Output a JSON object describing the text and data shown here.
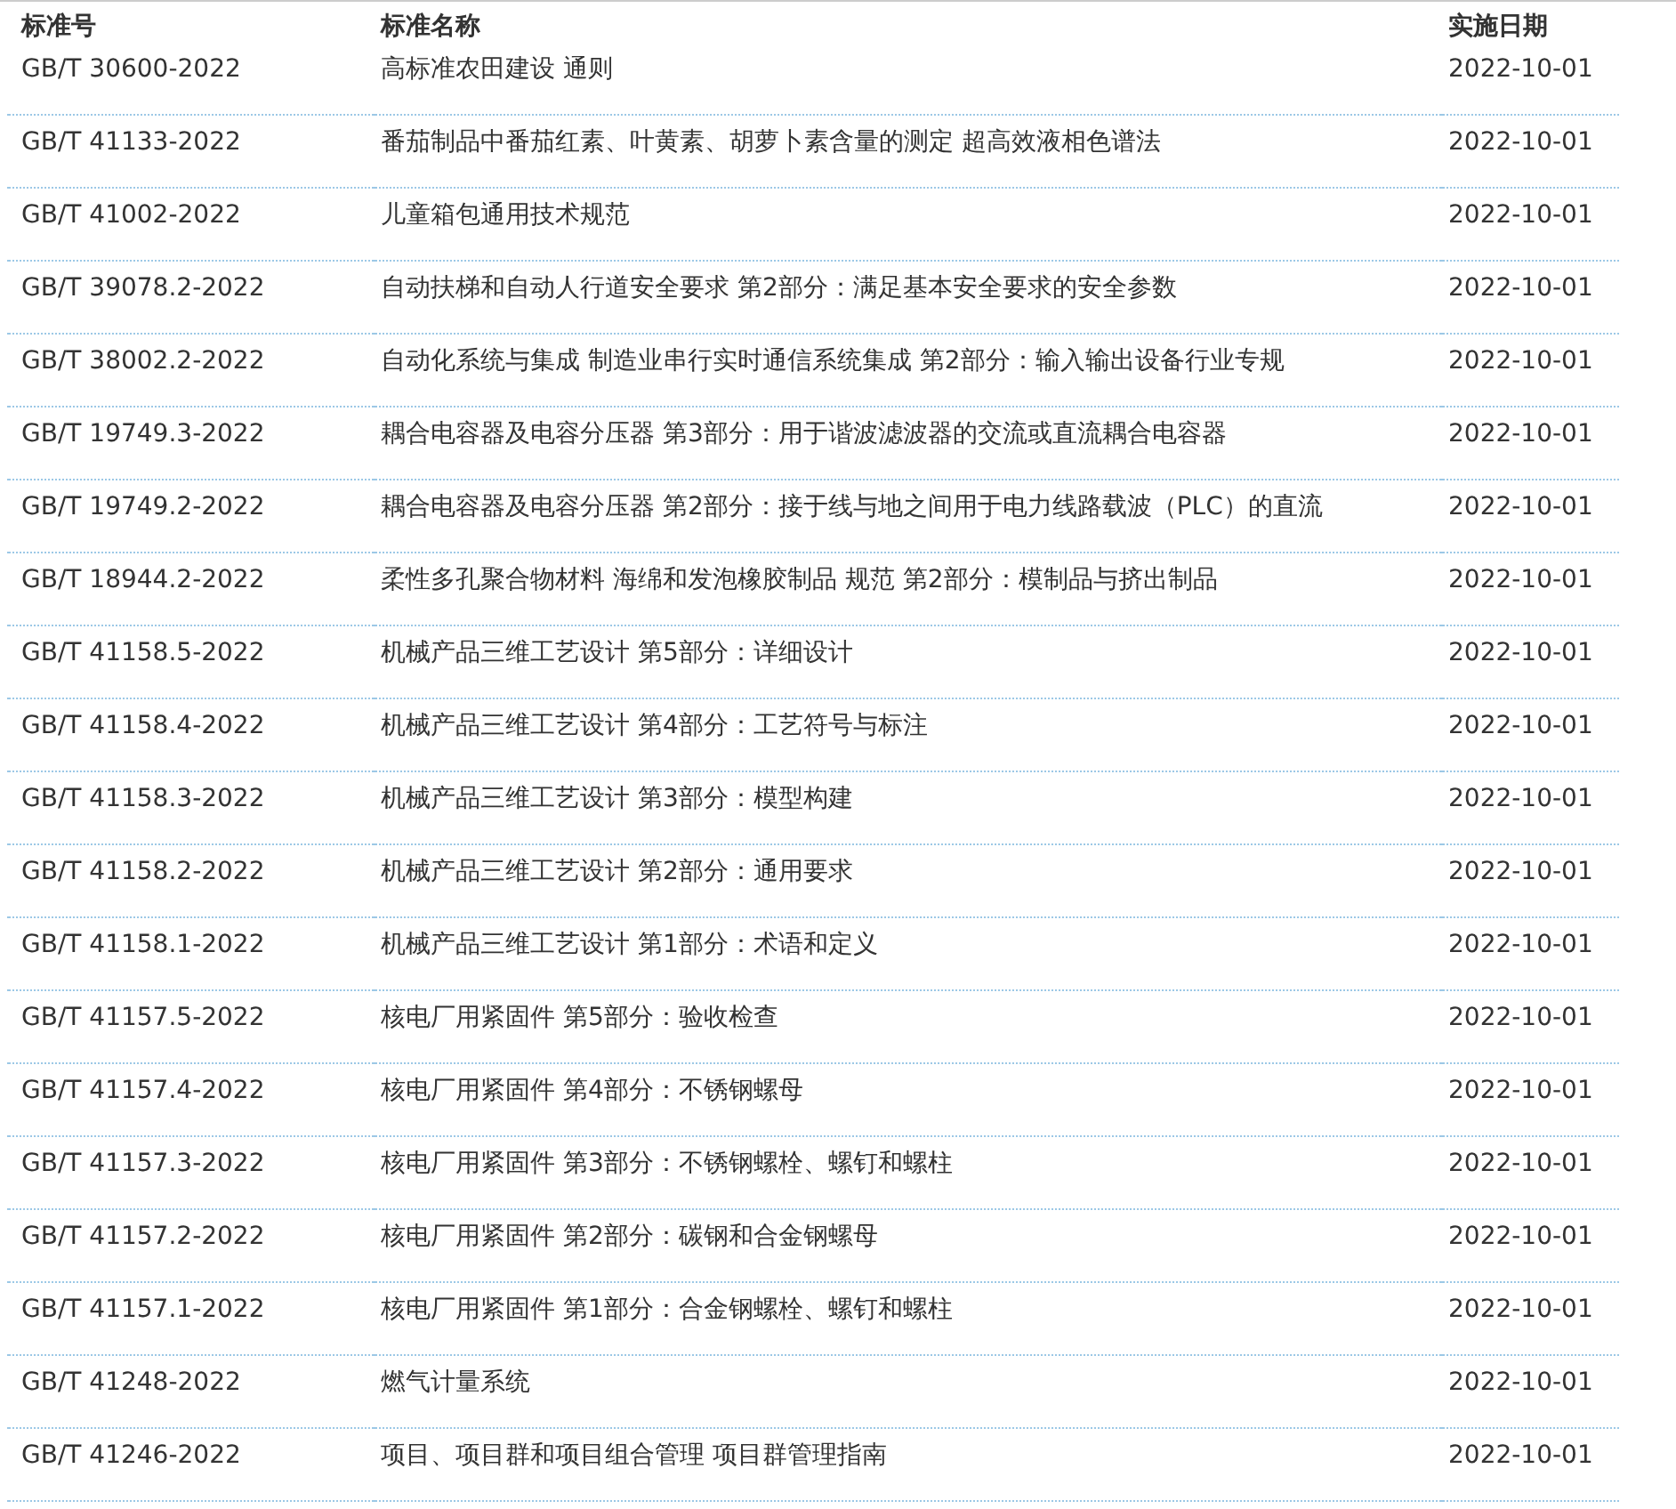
{
  "table": {
    "columns": [
      "标准号",
      "标准名称",
      "实施日期"
    ],
    "rows": [
      {
        "code": "GB/T 30600-2022",
        "name": "高标准农田建设 通则",
        "date": "2022-10-01"
      },
      {
        "code": "GB/T 41133-2022",
        "name": "番茄制品中番茄红素、叶黄素、胡萝卜素含量的测定 超高效液相色谱法",
        "date": "2022-10-01"
      },
      {
        "code": "GB/T 41002-2022",
        "name": "儿童箱包通用技术规范",
        "date": "2022-10-01"
      },
      {
        "code": "GB/T 39078.2-2022",
        "name": "自动扶梯和自动人行道安全要求 第2部分：满足基本安全要求的安全参数",
        "date": "2022-10-01"
      },
      {
        "code": "GB/T 38002.2-2022",
        "name": "自动化系统与集成 制造业串行实时通信系统集成 第2部分：输入输出设备行业专规",
        "date": "2022-10-01"
      },
      {
        "code": "GB/T 19749.3-2022",
        "name": "耦合电容器及电容分压器 第3部分：用于谐波滤波器的交流或直流耦合电容器",
        "date": "2022-10-01"
      },
      {
        "code": "GB/T 19749.2-2022",
        "name": "耦合电容器及电容分压器 第2部分：接于线与地之间用于电力线路载波（PLC）的直流",
        "date": "2022-10-01"
      },
      {
        "code": "GB/T 18944.2-2022",
        "name": "柔性多孔聚合物材料 海绵和发泡橡胶制品 规范 第2部分：模制品与挤出制品",
        "date": "2022-10-01"
      },
      {
        "code": "GB/T 41158.5-2022",
        "name": "机械产品三维工艺设计 第5部分：详细设计",
        "date": "2022-10-01"
      },
      {
        "code": "GB/T 41158.4-2022",
        "name": "机械产品三维工艺设计 第4部分：工艺符号与标注",
        "date": "2022-10-01"
      },
      {
        "code": "GB/T 41158.3-2022",
        "name": "机械产品三维工艺设计 第3部分：模型构建",
        "date": "2022-10-01"
      },
      {
        "code": "GB/T 41158.2-2022",
        "name": "机械产品三维工艺设计 第2部分：通用要求",
        "date": "2022-10-01"
      },
      {
        "code": "GB/T 41158.1-2022",
        "name": "机械产品三维工艺设计 第1部分：术语和定义",
        "date": "2022-10-01"
      },
      {
        "code": "GB/T 41157.5-2022",
        "name": "核电厂用紧固件 第5部分：验收检查",
        "date": "2022-10-01"
      },
      {
        "code": "GB/T 41157.4-2022",
        "name": "核电厂用紧固件 第4部分：不锈钢螺母",
        "date": "2022-10-01"
      },
      {
        "code": "GB/T 41157.3-2022",
        "name": "核电厂用紧固件 第3部分：不锈钢螺栓、螺钉和螺柱",
        "date": "2022-10-01"
      },
      {
        "code": "GB/T 41157.2-2022",
        "name": "核电厂用紧固件 第2部分：碳钢和合金钢螺母",
        "date": "2022-10-01"
      },
      {
        "code": "GB/T 41157.1-2022",
        "name": "核电厂用紧固件 第1部分：合金钢螺栓、螺钉和螺柱",
        "date": "2022-10-01"
      },
      {
        "code": "GB/T 41248-2022",
        "name": "燃气计量系统",
        "date": "2022-10-01"
      },
      {
        "code": "GB/T 41246-2022",
        "name": "项目、项目群和项目组合管理 项目群管理指南",
        "date": "2022-10-01"
      }
    ]
  }
}
